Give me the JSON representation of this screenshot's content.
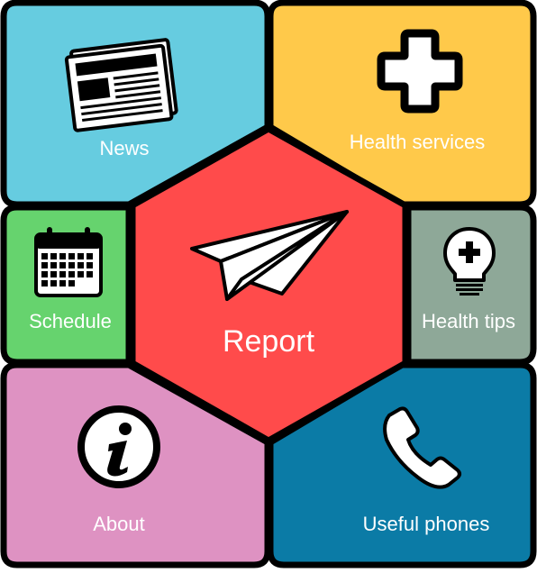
{
  "colors": {
    "news": "#66CCE0",
    "health_services": "#FFC94A",
    "schedule": "#66D36E",
    "health_tips": "#8EA898",
    "about": "#DE92C2",
    "useful_phones": "#0B7BA6",
    "report": "#FF4B4B",
    "border": "#000000",
    "label": "#FFFFFF"
  },
  "tiles": {
    "news": {
      "label": "News",
      "icon": "newspaper-icon"
    },
    "health_services": {
      "label": "Health services",
      "icon": "plus-icon"
    },
    "schedule": {
      "label": "Schedule",
      "icon": "calendar-icon"
    },
    "health_tips": {
      "label": "Health tips",
      "icon": "lightbulb-icon"
    },
    "about": {
      "label": "About",
      "icon": "info-icon"
    },
    "useful_phones": {
      "label": "Useful phones",
      "icon": "phone-icon"
    },
    "report": {
      "label": "Report",
      "icon": "paper-plane-icon"
    }
  }
}
